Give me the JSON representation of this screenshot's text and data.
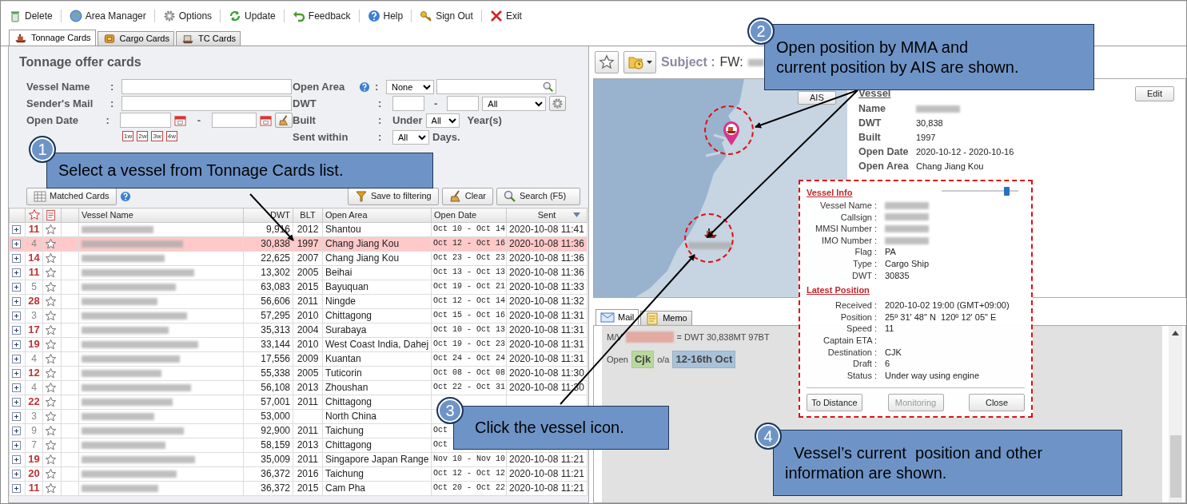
{
  "toolbar": [
    {
      "label": "Delete"
    },
    {
      "label": "Area Manager"
    },
    {
      "label": "Options"
    },
    {
      "label": "Update"
    },
    {
      "label": "Feedback"
    },
    {
      "label": "Help"
    },
    {
      "label": "Sign Out"
    },
    {
      "label": "Exit"
    }
  ],
  "tabs": [
    {
      "label": "Tonnage Cards",
      "selected": true
    },
    {
      "label": "Cargo Cards",
      "selected": false
    },
    {
      "label": "TC Cards",
      "selected": false
    }
  ],
  "filter": {
    "title": "Tonnage offer cards",
    "vessel_name": {
      "label": "Vessel Name",
      "colon": ":"
    },
    "senders_mail": {
      "label": "Sender's Mail",
      "colon": ":"
    },
    "open_date": {
      "label": "Open Date",
      "colon": ":",
      "dash": "-",
      "week_buttons": [
        "1w",
        "2w",
        "3w",
        "4w"
      ]
    },
    "open_area": {
      "label": "Open Area",
      "colon": ":",
      "select": "None"
    },
    "dwt": {
      "label": "DWT",
      "colon": ":",
      "dash": "-",
      "select": "All"
    },
    "built": {
      "label": "Built",
      "colon": ":",
      "prefix": "Under",
      "select": "All",
      "suffix": "Year(s)"
    },
    "sent_within": {
      "label": "Sent within",
      "colon": ":",
      "select": "All",
      "suffix": "Days."
    },
    "buttons": [
      {
        "label": "Matched Cards"
      },
      {
        "label": "Save to filtering"
      },
      {
        "label": "Clear"
      },
      {
        "label": "Search (F5)"
      }
    ]
  },
  "table": {
    "columns": [
      {
        "label": "Vessel Name",
        "sorted": false
      },
      {
        "label": "DWT",
        "sorted": false
      },
      {
        "label": "BLT",
        "sorted": false
      },
      {
        "label": "Open Area",
        "sorted": false
      },
      {
        "label": "Open Date",
        "sorted": false
      },
      {
        "label": "Sent",
        "sorted": true
      }
    ],
    "rows": [
      {
        "count": "11",
        "emphasized": true,
        "dwt": "9,916",
        "built": "2012",
        "open_area": "Shantou",
        "open_date": "Oct 10 - Oct 14",
        "sent": "2020-10-08 11:41",
        "selected": false
      },
      {
        "count": "4",
        "emphasized": false,
        "dwt": "30,838",
        "built": "1997",
        "open_area": "Chang Jiang Kou",
        "open_date": "Oct 12 - Oct 16",
        "sent": "2020-10-08 11:36",
        "selected": true
      },
      {
        "count": "14",
        "emphasized": true,
        "dwt": "22,625",
        "built": "2007",
        "open_area": "Chang Jiang Kou",
        "open_date": "Oct 23 - Oct 23",
        "sent": "2020-10-08 11:36",
        "selected": false
      },
      {
        "count": "11",
        "emphasized": true,
        "dwt": "13,302",
        "built": "2005",
        "open_area": "Beihai",
        "open_date": "Oct 13 - Oct 13",
        "sent": "2020-10-08 11:36",
        "selected": false
      },
      {
        "count": "5",
        "emphasized": false,
        "dwt": "63,083",
        "built": "2015",
        "open_area": "Bayuquan",
        "open_date": "Oct 19 - Oct 21",
        "sent": "2020-10-08 11:33",
        "selected": false
      },
      {
        "count": "28",
        "emphasized": true,
        "dwt": "56,606",
        "built": "2011",
        "open_area": "Ningde",
        "open_date": "Oct 12 - Oct 14",
        "sent": "2020-10-08 11:32",
        "selected": false
      },
      {
        "count": "3",
        "emphasized": false,
        "dwt": "57,295",
        "built": "2010",
        "open_area": "Chittagong",
        "open_date": "Oct 15 - Oct 16",
        "sent": "2020-10-08 11:31",
        "selected": false
      },
      {
        "count": "17",
        "emphasized": true,
        "dwt": "35,313",
        "built": "2004",
        "open_area": "Surabaya",
        "open_date": "Oct 10 - Oct 13",
        "sent": "2020-10-08 11:31",
        "selected": false
      },
      {
        "count": "19",
        "emphasized": true,
        "dwt": "33,144",
        "built": "2010",
        "open_area": "West Coast India, Dahej",
        "open_date": "Oct 19 - Oct 23",
        "sent": "2020-10-08 11:31",
        "selected": false
      },
      {
        "count": "4",
        "emphasized": false,
        "dwt": "17,556",
        "built": "2009",
        "open_area": "Kuantan",
        "open_date": "Oct 24 - Oct 24",
        "sent": "2020-10-08 11:31",
        "selected": false
      },
      {
        "count": "12",
        "emphasized": true,
        "dwt": "55,338",
        "built": "2005",
        "open_area": "Tuticorin",
        "open_date": "Oct 08 - Oct 08",
        "sent": "2020-10-08 11:30",
        "selected": false
      },
      {
        "count": "4",
        "emphasized": false,
        "dwt": "56,108",
        "built": "2013",
        "open_area": "Zhoushan",
        "open_date": "Oct 22 - Oct 31",
        "sent": "2020-10-08 11:30",
        "selected": false
      },
      {
        "count": "22",
        "emphasized": true,
        "dwt": "57,001",
        "built": "2011",
        "open_area": "Chittagong",
        "selected": false
      },
      {
        "count": "3",
        "emphasized": false,
        "dwt": "53,000",
        "open_area": "North China",
        "selected": false
      },
      {
        "count": "9",
        "emphasized": false,
        "dwt": "92,900",
        "built": "2011",
        "open_area": "Taichung",
        "open_date": "Oct",
        "selected": false
      },
      {
        "count": "7",
        "emphasized": false,
        "dwt": "58,159",
        "built": "2013",
        "open_area": "Chittagong",
        "open_date": "Oct",
        "selected": false
      },
      {
        "count": "19",
        "emphasized": true,
        "dwt": "35,009",
        "built": "2011",
        "open_area": "Singapore Japan Range",
        "open_date": "Nov 10 - Nov 10",
        "sent": "2020-10-08 11:21",
        "selected": false
      },
      {
        "count": "20",
        "emphasized": true,
        "dwt": "36,372",
        "built": "2016",
        "open_area": "Taichung",
        "open_date": "Oct 12 - Oct 12",
        "sent": "2020-10-08 11:21",
        "selected": false
      },
      {
        "count": "11",
        "emphasized": true,
        "dwt": "36,372",
        "built": "2015",
        "open_area": "Cam Pha",
        "open_date": "Oct 20 - Oct 22",
        "sent": "2020-10-08 11:21",
        "selected": false
      }
    ]
  },
  "subject": {
    "label": "Subject :",
    "value": "FW:"
  },
  "map": {
    "ais_button": "AIS"
  },
  "vessel": {
    "heading": "Vessel",
    "edit_button": "Edit",
    "fields": [
      {
        "label": "Name",
        "blurred": true
      },
      {
        "label": "DWT",
        "value": "30,838"
      },
      {
        "label": "Built",
        "value": "1997"
      },
      {
        "label": "Open Date",
        "value": "2020-10-12 - 2020-10-16"
      },
      {
        "label": "Open Area",
        "value": "Chang Jiang Kou"
      }
    ]
  },
  "popup": {
    "vessel_info": {
      "heading": "Vessel Info",
      "level": 0.85,
      "fields": [
        {
          "label": "Vessel Name :",
          "blurred": true
        },
        {
          "label": "Callsign :",
          "blurred": true
        },
        {
          "label": "MMSI Number :",
          "blurred": true
        },
        {
          "label": "IMO Number :",
          "blurred": true
        },
        {
          "label": "Flag :",
          "value": "PA"
        },
        {
          "label": "Type :",
          "value": "Cargo Ship"
        },
        {
          "label": "DWT :",
          "value": "30835"
        }
      ]
    },
    "latest_position": {
      "heading": "Latest Position",
      "fields": [
        {
          "label": "Received :",
          "value": "2020-10-02 19:00 (GMT+09:00)"
        },
        {
          "label": "Position :",
          "value": "25º 31' 48\" N  120º 12' 05\" E"
        },
        {
          "label": "Speed :",
          "value": "11"
        },
        {
          "label": "Captain ETA :"
        },
        {
          "label": "Destination :",
          "value": "CJK"
        },
        {
          "label": "Draft :",
          "value": "6"
        },
        {
          "label": "Status :",
          "value": "Under way using engine"
        }
      ]
    },
    "buttons": [
      {
        "label": "To Distance",
        "disabled": false
      },
      {
        "label": "Monitoring",
        "disabled": true
      },
      {
        "label": "Close",
        "disabled": false
      }
    ]
  },
  "mail": {
    "tabs": [
      {
        "label": "Mail",
        "selected": true
      },
      {
        "label": "Memo",
        "selected": false
      }
    ],
    "lines": [
      {
        "parts": [
          {
            "kind": "text",
            "text": "M/V"
          },
          {
            "kind": "blurred",
            "color": "#e3aaa2"
          },
          {
            "kind": "text",
            "text": "= DWT 30,838MT 97BT"
          }
        ]
      },
      {
        "parts": [
          {
            "kind": "text",
            "text": "Open"
          },
          {
            "kind": "highlight",
            "text": "Cjk",
            "color": "#b9d99c"
          },
          {
            "kind": "text",
            "text": "o/a"
          },
          {
            "kind": "highlight",
            "text": "12-16th Oct",
            "color": "#a8c2da"
          }
        ]
      }
    ]
  },
  "callouts": [
    {
      "number": "1",
      "lines": [
        "Select a vessel from Tonnage Cards list."
      ]
    },
    {
      "number": "2",
      "lines": [
        "Open position by MMA and",
        "current position by AIS are shown."
      ]
    },
    {
      "number": "3",
      "lines": [
        "Click the vessel icon."
      ]
    },
    {
      "number": "4",
      "lines": [
        "  Vessel’s current  position and other",
        "information are shown."
      ]
    }
  ]
}
